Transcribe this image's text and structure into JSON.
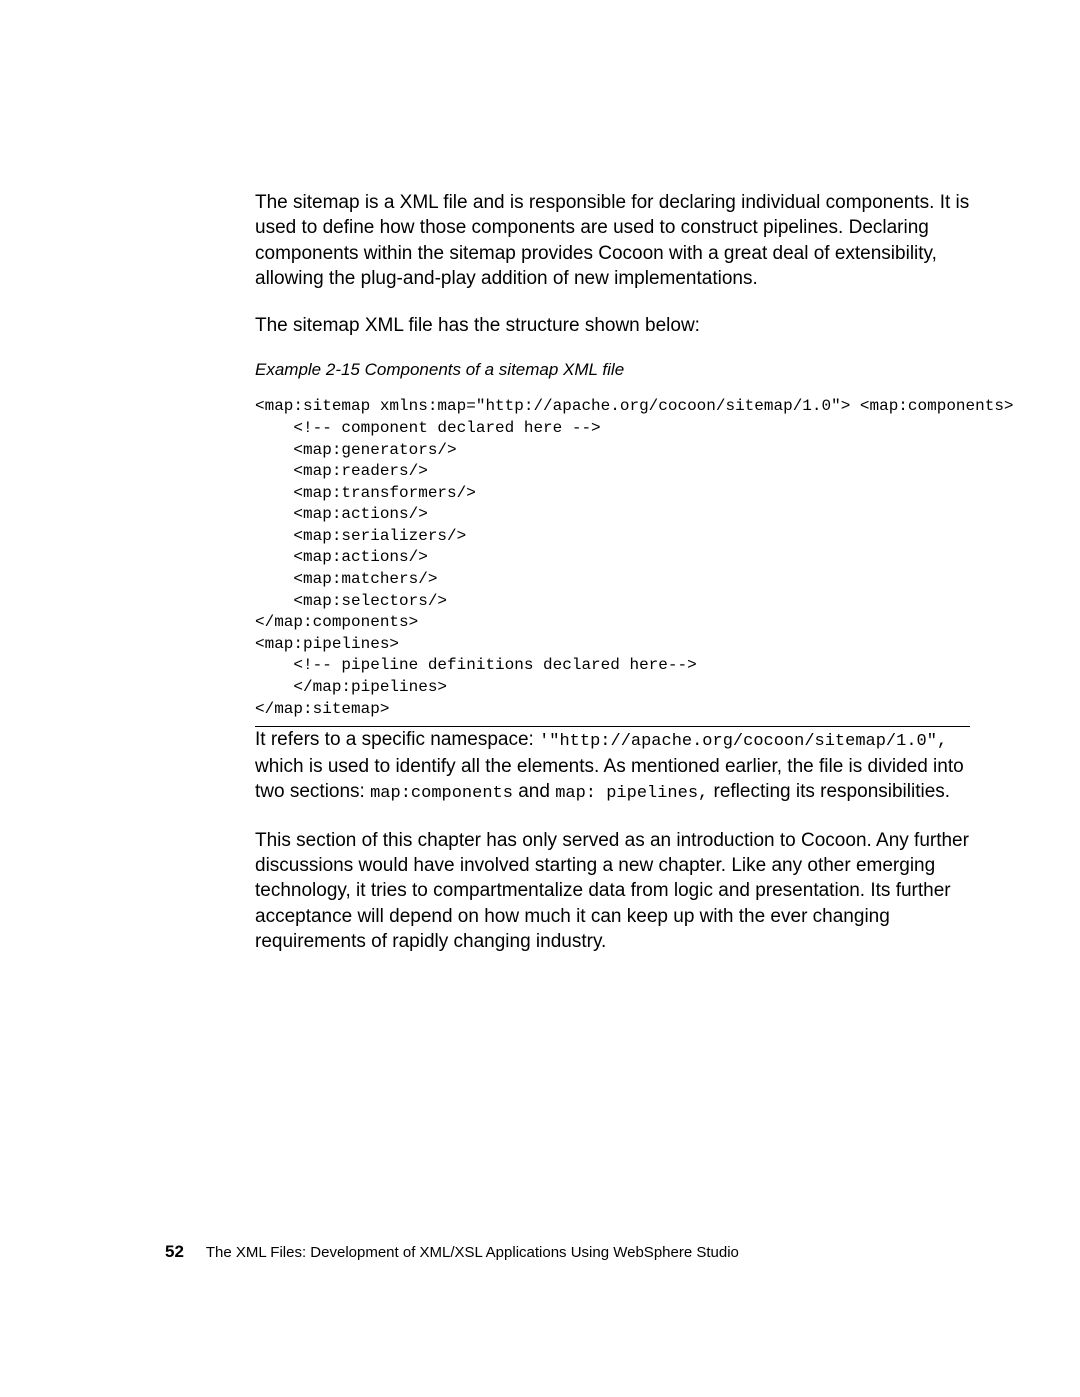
{
  "para1": "The sitemap is a XML file and is responsible for declaring individual components. It is used to define how those components are used to construct pipelines. Declaring components within the sitemap provides Cocoon with a great deal of extensibility, allowing the plug-and-play addition of new implementations.",
  "para2": "The sitemap XML file has the structure shown below:",
  "exampleCaption": "Example 2-15   Components of a sitemap XML file",
  "code": "<map:sitemap xmlns:map=\"http://apache.org/cocoon/sitemap/1.0\"> <map:components>\n    <!-- component declared here -->\n    <map:generators/>\n    <map:readers/>\n    <map:transformers/>\n    <map:actions/>\n    <map:serializers/>\n    <map:actions/>\n    <map:matchers/>\n    <map:selectors/>\n</map:components>\n<map:pipelines>\n    <!-- pipeline definitions declared here-->\n    </map:pipelines>\n</map:sitemap>",
  "para3": {
    "t1": "It refers to a specific namespace: ",
    "c1": "'\"http://apache.org/cocoon/sitemap/1.0\",",
    "t2": " which is used to identify all the elements. As mentioned earlier, the file is divided into two sections: ",
    "c2": "map:components",
    "t3": " and ",
    "c3": "map: pipelines,",
    "t4": " reflecting its responsibilities."
  },
  "para4": "This section of this chapter has only served as an introduction to Cocoon. Any further discussions would have involved starting a new chapter. Like any other emerging technology, it tries to compartmentalize data from logic and presentation. Its further acceptance will depend on how much it can keep up with the ever changing requirements of rapidly changing industry.",
  "footer": {
    "page": "52",
    "title": "The XML Files:   Development of XML/XSL Applications Using WebSphere Studio"
  }
}
